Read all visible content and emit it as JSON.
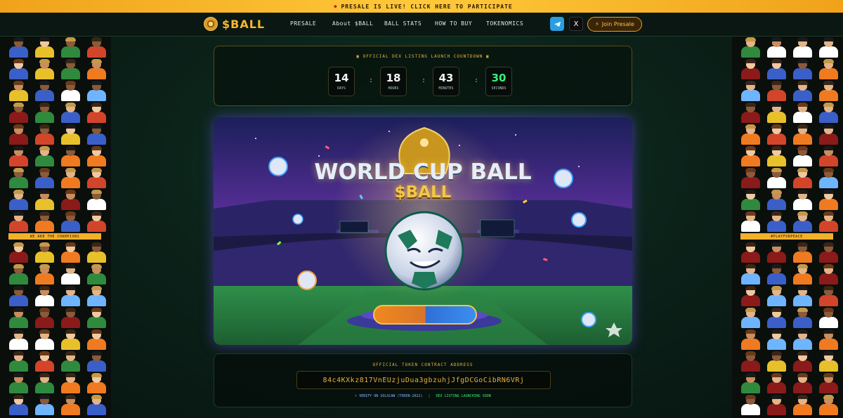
{
  "banner": {
    "text": "PRESALE IS LIVE! CLICK HERE TO PARTICIPATE"
  },
  "nav": {
    "logo_text": "$BALL",
    "links": [
      "PRESALE",
      "About $BALL",
      "BALL STATS",
      "HOW TO BUY",
      "TOKENOMICS"
    ],
    "telegram_icon": "telegram-icon",
    "x_icon": "x-icon",
    "x_glyph": "X",
    "join_label": "Join Presale"
  },
  "sidebars": {
    "left_strip": "WE ARE THE CHAMPIONS",
    "right_strip": "#PLAYFORPEACE"
  },
  "countdown": {
    "title": "OFFICIAL DEX LISTING LAUNCH COUNTDOWN",
    "units": [
      {
        "value": "14",
        "label": "DAYS"
      },
      {
        "value": "18",
        "label": "HOURS"
      },
      {
        "value": "43",
        "label": "MINUTES"
      },
      {
        "value": "30",
        "label": "SECONDS"
      }
    ]
  },
  "hero": {
    "title": "WORLD CUP BALL",
    "subtitle": "$BALL",
    "scoreboard_text": "BALL"
  },
  "contract": {
    "title": "OFFICIAL TOKEN CONTRACT ADDRESS",
    "address": "84c4KXkz817VnEUzjuDua3gbzuhjJfgDCGoCibRN6VRj",
    "verify_link": "VERIFY ON SOLSCAN (TOKEN-2022)",
    "status": "DEX LISTING LAUNCHING SOON"
  },
  "colors": {
    "accent_gold": "#f4b63a",
    "countdown_seconds": "#39f07c",
    "banner_bg": "#ffc93a"
  }
}
